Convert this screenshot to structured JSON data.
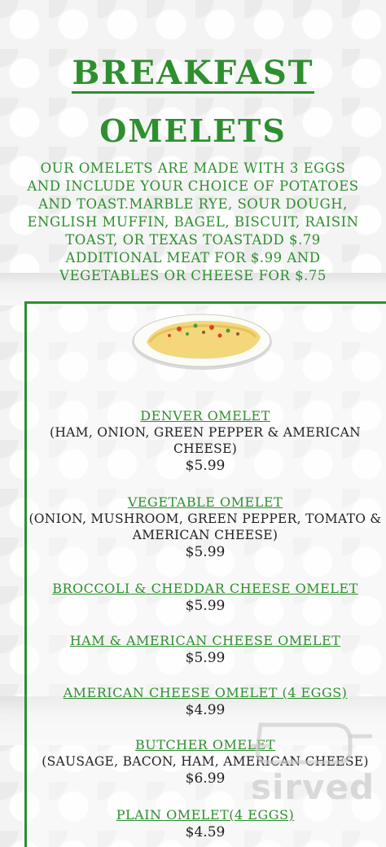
{
  "header": {
    "title": "Breakfast",
    "subtitle": "Omelets",
    "intro": "Our omelets are made with 3 eggs and include your choice of potatoes and toast.Marble rye, sour dough, English muffin, bagel, biscuit, raisin toast, or Texas toastadd $.79 additional meat for $.99 and vegetables or cheese for $.75"
  },
  "items": [
    {
      "name": "Denver Omelet",
      "desc": "(Ham, Onion, Green Pepper & American Cheese)",
      "price": "$5.99"
    },
    {
      "name": "Vegetable Omelet",
      "desc": "(Onion, Mushroom, Green Pepper, Tomato & American Cheese)",
      "price": "$5.99"
    },
    {
      "name": "Broccoli & Cheddar Cheese Omelet",
      "desc": "",
      "price": "$5.99"
    },
    {
      "name": "Ham & American Cheese Omelet",
      "desc": "",
      "price": "$5.99"
    },
    {
      "name": "American Cheese Omelet (4 Eggs)",
      "desc": "",
      "price": "$4.99"
    },
    {
      "name": "Butcher Omelet",
      "desc": "(Sausage, Bacon, Ham, American Cheese)",
      "price": "$6.99"
    },
    {
      "name": "Plain Omelet(4 Eggs)",
      "desc": "",
      "price": "$4.59"
    }
  ],
  "watermark": {
    "text": "sirved"
  },
  "colors": {
    "accent": "#2e8f2f",
    "text": "#222222"
  }
}
